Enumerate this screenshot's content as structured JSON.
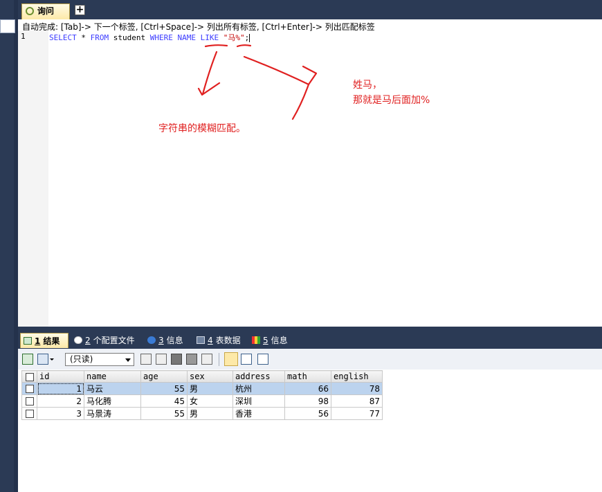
{
  "tabs": {
    "query_label": "询问",
    "add_label": "+"
  },
  "editor": {
    "autocomplete_hint": "自动完成: [Tab]-> 下一个标签, [Ctrl+Space]-> 列出所有标签, [Ctrl+Enter]-> 列出匹配标签",
    "line_number": "1",
    "sql": {
      "kw_select": "SELECT",
      "star": " * ",
      "kw_from": "FROM",
      "table": " student ",
      "kw_where": "WHERE",
      "space1": " ",
      "kw_name": "NAME",
      "space2": " ",
      "kw_like": "LIKE",
      "space3": " ",
      "pattern": "\"马%\"",
      "semicolon": ";"
    }
  },
  "annotations": {
    "fuzzy_match": "字符串的模糊匹配。",
    "surname_line1": "姓马，",
    "surname_line2": "那就是马后面加%",
    "color": "#e02020"
  },
  "result_tabs": [
    {
      "num": "1",
      "label": "结果",
      "icon": "grid-icon"
    },
    {
      "num": "2",
      "label": "个配置文件",
      "icon": "profile-icon"
    },
    {
      "num": "3",
      "label": "信息",
      "icon": "info-icon"
    },
    {
      "num": "4",
      "label": "表数据",
      "icon": "table-icon"
    },
    {
      "num": "5",
      "label": "信息",
      "icon": "info-color-icon"
    }
  ],
  "toolbar": {
    "mode_select": "(只读)"
  },
  "grid": {
    "columns": [
      "id",
      "name",
      "age",
      "sex",
      "address",
      "math",
      "english"
    ],
    "rows": [
      {
        "id": "1",
        "name": "马云",
        "age": "55",
        "sex": "男",
        "address": "杭州",
        "math": "66",
        "english": "78"
      },
      {
        "id": "2",
        "name": "马化腾",
        "age": "45",
        "sex": "女",
        "address": "深圳",
        "math": "98",
        "english": "87"
      },
      {
        "id": "3",
        "name": "马景涛",
        "age": "55",
        "sex": "男",
        "address": "香港",
        "math": "56",
        "english": "77"
      }
    ]
  },
  "colors": {
    "frame": "#2b3a55",
    "keyword": "#3b3bff",
    "string": "#c30000",
    "selected_row": "#bcd3ee"
  }
}
